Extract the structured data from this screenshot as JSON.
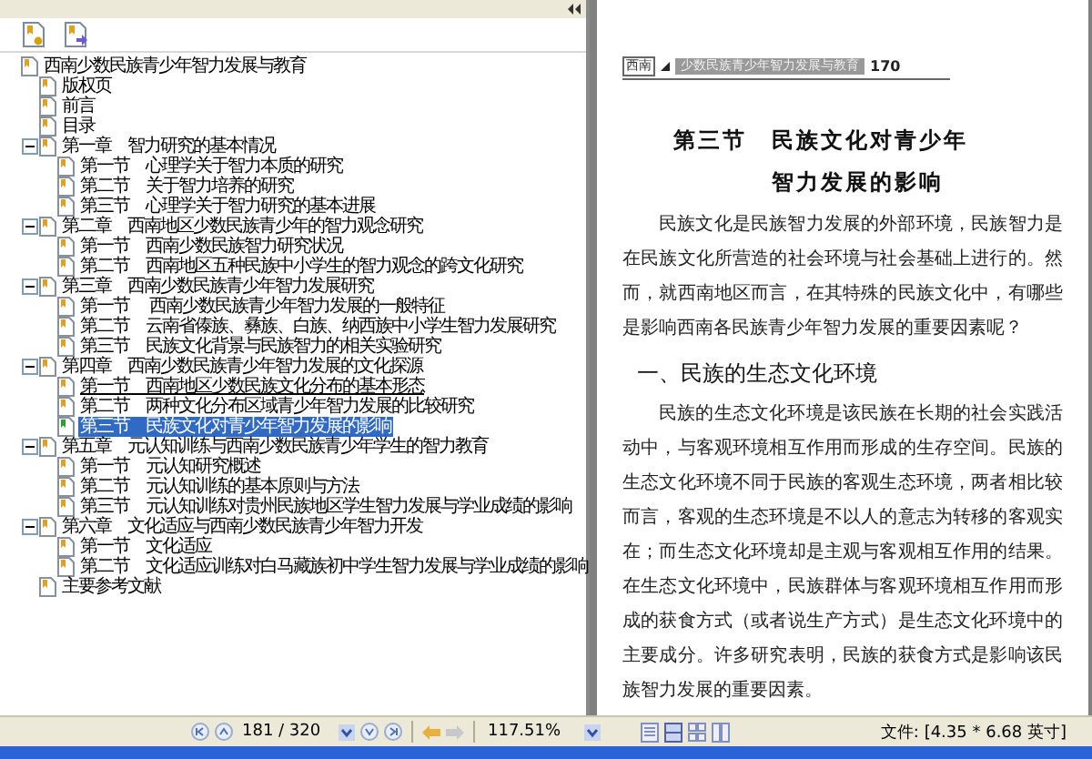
{
  "bookmarks": [
    {
      "label": "西南少数民族青少年智力发展与教育",
      "selected": false,
      "hovered": false,
      "children": [
        {
          "label": "版权页",
          "selected": false,
          "hovered": false
        },
        {
          "label": "前言",
          "selected": false,
          "hovered": false
        },
        {
          "label": "目录",
          "selected": false,
          "hovered": false
        },
        {
          "label": "第一章　智力研究的基本情况",
          "selected": false,
          "hovered": false,
          "expanded": true,
          "children": [
            {
              "label": "第一节　心理学关于智力本质的研究",
              "selected": false,
              "hovered": false
            },
            {
              "label": "第二节　关于智力培养的研究",
              "selected": false,
              "hovered": false
            },
            {
              "label": "第三节　心理学关于智力研究的基本进展",
              "selected": false,
              "hovered": false
            }
          ]
        },
        {
          "label": "第二章　西南地区少数民族青少年的智力观念研究",
          "selected": false,
          "hovered": false,
          "expanded": true,
          "children": [
            {
              "label": "第一节　西南少数民族智力研究状况",
              "selected": false,
              "hovered": false
            },
            {
              "label": "第二节　西南地区五种民族中小学生的智力观念的跨文化研究",
              "selected": false,
              "hovered": false
            }
          ]
        },
        {
          "label": "第三章　西南少数民族青少年智力发展研究",
          "selected": false,
          "hovered": false,
          "expanded": true,
          "children": [
            {
              "label": "第一节　 西南少数民族青少年智力发展的一般特征",
              "selected": false,
              "hovered": false
            },
            {
              "label": "第二节　云南省傣族、彝族、白族、纳西族中小学生智力发展研究",
              "selected": false,
              "hovered": false
            },
            {
              "label": "第三节　民族文化背景与民族智力的相关实验研究",
              "selected": false,
              "hovered": false
            }
          ]
        },
        {
          "label": "第四章　西南少数民族青少年智力发展的文化探源",
          "selected": false,
          "hovered": false,
          "expanded": true,
          "children": [
            {
              "label": "第一节　西南地区少数民族文化分布的基本形态",
              "selected": false,
              "hovered": true
            },
            {
              "label": "第二节　两种文化分布区域青少年智力发展的比较研究",
              "selected": false,
              "hovered": false
            },
            {
              "label": "第三节　民族文化对青少年智力发展的影响",
              "selected": true,
              "hovered": false
            }
          ]
        },
        {
          "label": "第五章　元认知训练与西南少数民族青少年学生的智力教育",
          "selected": false,
          "hovered": false,
          "expanded": true,
          "children": [
            {
              "label": "第一节　元认知研究概述",
              "selected": false,
              "hovered": false
            },
            {
              "label": "第二节　元认知训练的基本原则与方法",
              "selected": false,
              "hovered": false
            },
            {
              "label": "第三节　元认知训练对贵州民族地区学生智力发展与学业成绩的影响",
              "selected": false,
              "hovered": false
            }
          ]
        },
        {
          "label": "第六章　文化适应与西南少数民族青少年智力开发",
          "selected": false,
          "hovered": false,
          "expanded": true,
          "children": [
            {
              "label": "第一节　文化适应",
              "selected": false,
              "hovered": false
            },
            {
              "label": "第二节　文化适应训练对白马藏族初中学生智力发展与学业成绩的影响",
              "selected": false,
              "hovered": false
            }
          ]
        },
        {
          "label": "主要参考文献",
          "selected": false,
          "hovered": false
        }
      ]
    }
  ],
  "document": {
    "header": {
      "tag": "西南",
      "running_title": "少数民族青少年智力发展与教育",
      "page_number": "170"
    },
    "title_lines": [
      "第三节　民族文化对青少年",
      "智力发展的影响"
    ],
    "blocks": [
      {
        "kind": "paragraph",
        "text": "民族文化是民族智力发展的外部环境，民族智力是在民族文化所营造的社会环境与社会基础上进行的。然而，就西南地区而言，在其特殊的民族文化中，有哪些是影响西南各民族青少年智力发展的重要因素呢？"
      },
      {
        "kind": "heading",
        "text": "一、民族的生态文化环境"
      },
      {
        "kind": "paragraph",
        "text": "民族的生态文化环境是该民族在长期的社会实践活动中，与客观环境相互作用而形成的生存空间。民族的生态文化环境不同于民族的客观生态环境，两者相比较而言，客观的生态环境是不以人的意志为转移的客观实在；而生态文化环境却是主观与客观相互作用的结果。在生态文化环境中，民族群体与客观环境相互作用而形成的获食方式（或者说生产方式）是生态文化环境中的主要成分。许多研究表明，民族的获食方式是影响该民族智力发展的重要因素。"
      }
    ]
  },
  "status_bar": {
    "page_field": "181 / 320",
    "zoom_field": "117.51%",
    "file_size": "文件: [4.35 * 6.68 英寸]"
  }
}
